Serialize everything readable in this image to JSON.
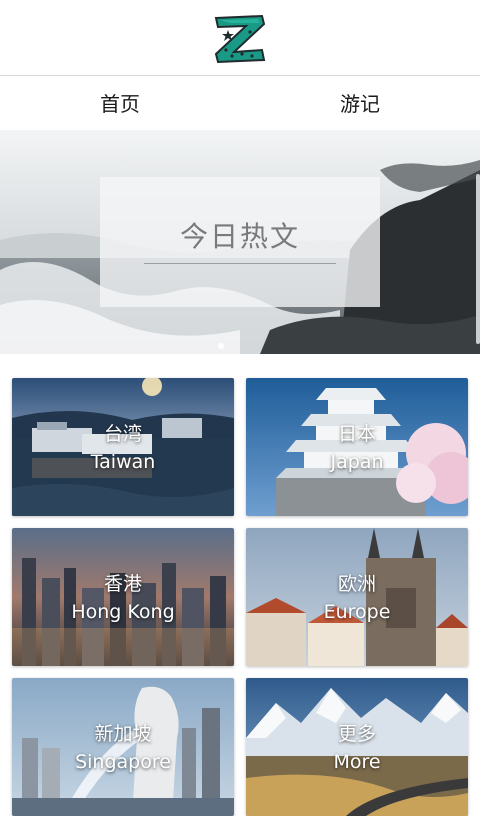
{
  "header": {
    "logo_icon": "z-logo-icon",
    "colors": {
      "logo_teal": "#1a9a86",
      "logo_dark": "#1f2b2d"
    }
  },
  "nav": {
    "tabs": [
      {
        "label": "首页"
      },
      {
        "label": "游记"
      }
    ]
  },
  "banner": {
    "title": "今日热文"
  },
  "destinations": [
    {
      "cn": "台湾",
      "en": "Taiwan"
    },
    {
      "cn": "日本",
      "en": "Japan"
    },
    {
      "cn": "香港",
      "en": "Hong Kong"
    },
    {
      "cn": "欧洲",
      "en": "Europe"
    },
    {
      "cn": "新加坡",
      "en": "Singapore"
    },
    {
      "cn": "更多",
      "en": "More"
    }
  ]
}
